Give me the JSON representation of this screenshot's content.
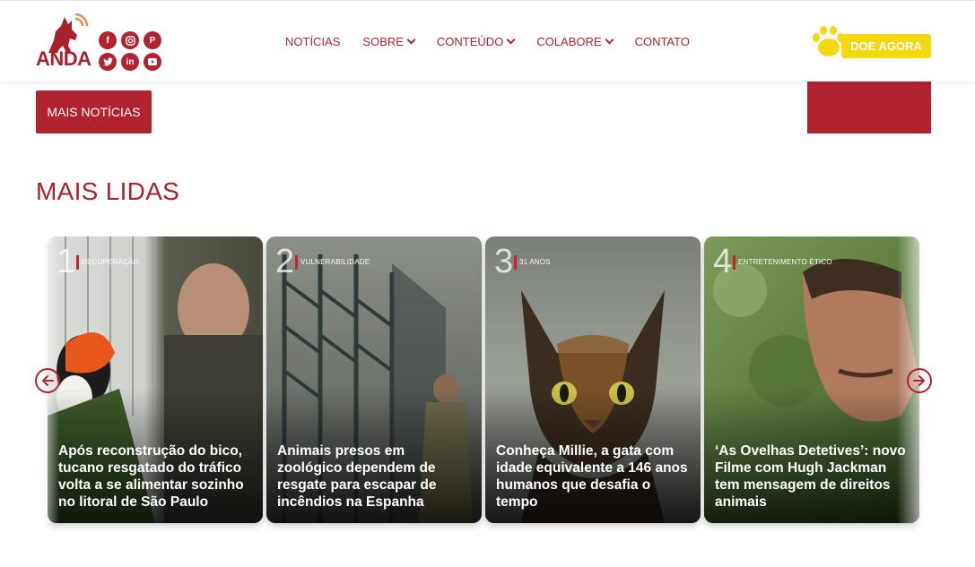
{
  "header": {
    "logo_text": "ANDA",
    "social_icons": [
      "facebook-icon",
      "instagram-icon",
      "pinterest-icon",
      "twitter-icon",
      "linkedin-icon",
      "youtube-icon"
    ],
    "nav": [
      {
        "label": "NOTÍCIAS",
        "dropdown": false
      },
      {
        "label": "SOBRE",
        "dropdown": true
      },
      {
        "label": "CONTEÚDO",
        "dropdown": true
      },
      {
        "label": "COLABORE",
        "dropdown": true
      },
      {
        "label": "CONTATO",
        "dropdown": false
      }
    ],
    "donate_label": "DOE AGORA"
  },
  "main": {
    "more_news_label": "MAIS NOTÍCIAS",
    "section_title": "MAIS LIDAS"
  },
  "cards": [
    {
      "num": "1",
      "tag": "RECUPERAÇÃO",
      "title": "Após reconstrução do bico, tucano resgatado do tráfico volta a se alimentar sozinho no litoral de São Paulo"
    },
    {
      "num": "2",
      "tag": "VULNERABILIDADE",
      "title": "Animais presos em zoológico dependem de resgate para escapar de incêndios na Espanha"
    },
    {
      "num": "3",
      "tag": "31 ANOS",
      "title": "Conheça Millie, a gata com idade equivalente a 146 anos humanos que desafia o tempo"
    },
    {
      "num": "4",
      "tag": "ENTRETENIMENTO ÉTICO",
      "title": "‘As Ovelhas Detetives’: novo Filme com Hugh Jackman tem mensagem de direitos animais"
    }
  ],
  "colors": {
    "brand_red": "#b0232f",
    "donate_yellow": "#f5d90f"
  }
}
